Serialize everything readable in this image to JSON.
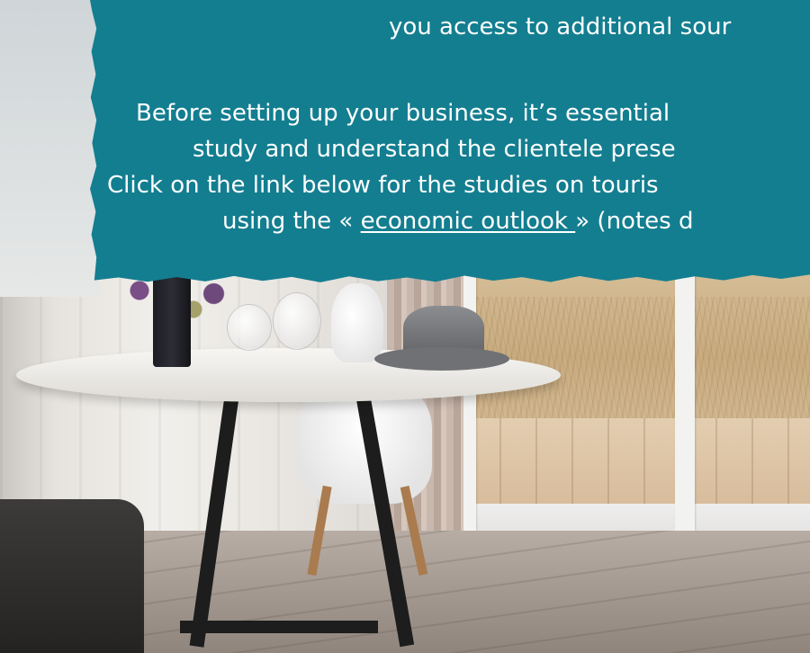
{
  "banner": {
    "line1": "you access to additional sour",
    "line2": "Before setting up your business, it’s essential",
    "line3": "study and understand the clientele prese",
    "line4": "Click on the link below for the studies on touris",
    "line5_pre": "using the « ",
    "line5_link": "economic outlook ",
    "line5_post": "» (notes d",
    "background_color": "#137e90",
    "text_color": "#ffffff"
  },
  "photo": {
    "description_icon": "dining-table-photo"
  }
}
